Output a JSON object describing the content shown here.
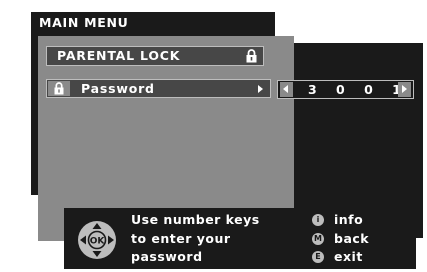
{
  "main_menu": {
    "title": "MAIN MENU"
  },
  "parental_lock": {
    "title": "PARENTAL LOCK",
    "header_icon": "lock-icon",
    "password_row": {
      "icon": "lock-icon",
      "label": "Password",
      "value": "3001",
      "value_display": "3 0 0 1"
    }
  },
  "help": {
    "lines": [
      "Use number keys",
      "to enter your",
      "password"
    ],
    "legend": [
      {
        "key": "i",
        "label": "info"
      },
      {
        "key": "M",
        "label": "back"
      },
      {
        "key": "E",
        "label": "exit"
      }
    ],
    "nav_center": "OK"
  },
  "colors": {
    "dark": "#1a1a1a",
    "panel": "#8a8a8a",
    "row": "#474747",
    "light": "#bdbdbd",
    "text": "#ffffff"
  }
}
